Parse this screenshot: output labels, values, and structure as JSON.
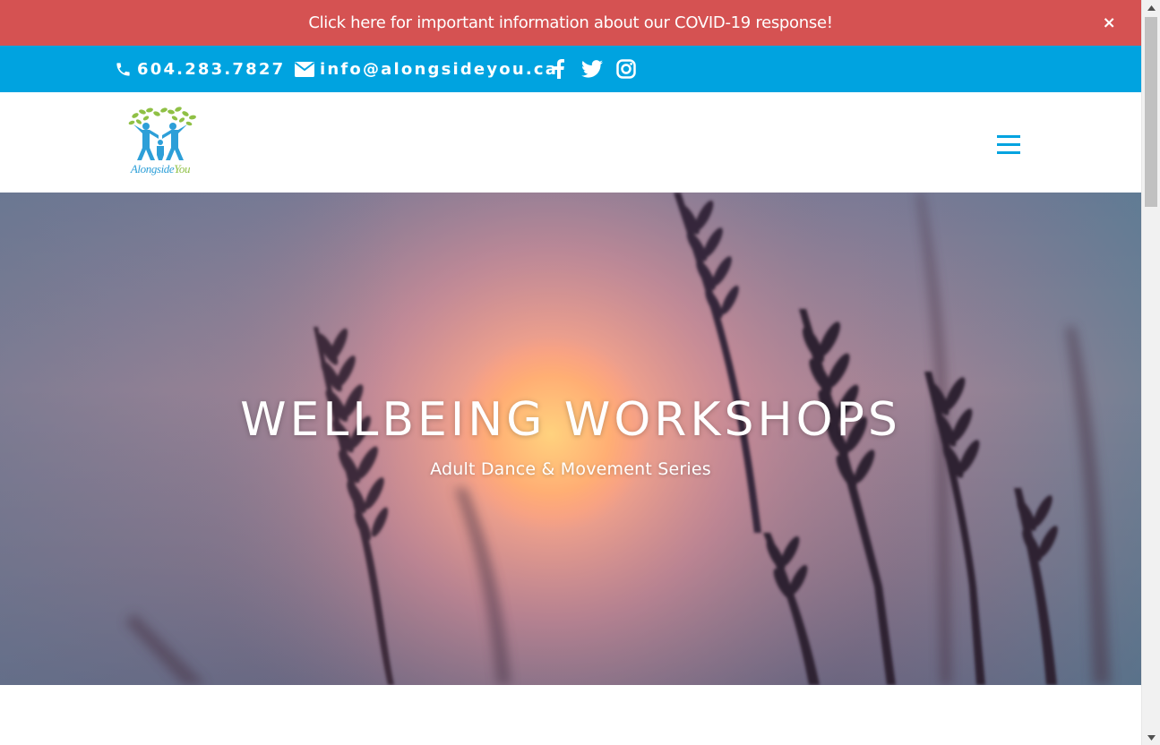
{
  "covid_banner": {
    "text": "Click here for important information about our COVID-19 response!",
    "close_label": "×"
  },
  "top_bar": {
    "phone": "604.283.7827",
    "email": "info@alongsideyou.ca",
    "social": [
      "facebook-icon",
      "twitter-icon",
      "instagram-icon"
    ]
  },
  "header": {
    "logo_text_main": "Alongside",
    "logo_text_accent": "You",
    "menu_icon": "hamburger-menu-icon"
  },
  "hero": {
    "title": "WELLBEING WORKSHOPS",
    "subtitle": "Adult Dance & Movement Series"
  },
  "colors": {
    "covid_banner_bg": "#d55252",
    "top_bar_bg": "#00a3e0",
    "accent": "#00a3e0",
    "logo_blue": "#2d9fd8",
    "logo_green": "#8fc045"
  }
}
